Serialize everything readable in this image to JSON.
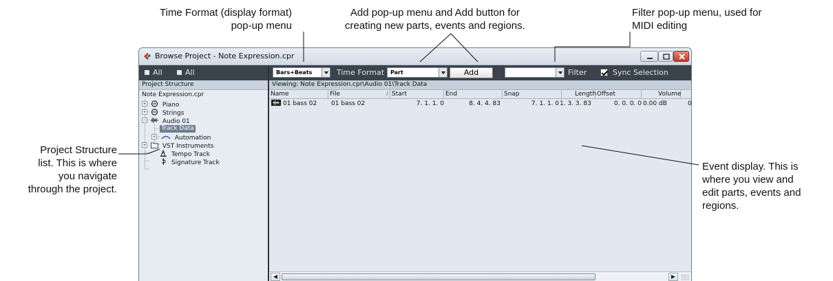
{
  "callouts": {
    "time_format": [
      "Time Format (display format)",
      "pop-up menu"
    ],
    "add_menu": [
      "Add pop-up menu and Add button for",
      "creating new parts, events and regions."
    ],
    "filter_menu": [
      "Filter pop-up menu, used for",
      "MIDI editing"
    ],
    "project_structure": [
      "Project Structure",
      "list. This is where",
      "you navigate",
      "through the project."
    ],
    "event_display": [
      "Event display. This is",
      "where you view and",
      "edit parts, events and",
      "regions."
    ]
  },
  "window": {
    "title": "Browse Project - Note Expression.cpr",
    "buttons": {
      "minimize": "minimize-icon",
      "maximize": "maximize-icon",
      "close": "close-icon"
    }
  },
  "toolbar": {
    "expand_all": "All",
    "collapse_all": "All",
    "time_format_value": "Bars+Beats",
    "time_format_label": "Time Format",
    "add_type_value": "Part",
    "add_button": "Add",
    "filter_value": "",
    "filter_label": "Filter",
    "sync_selection_label": "Sync Selection",
    "sync_selection_checked": true
  },
  "project_structure": {
    "header": "Project Structure",
    "items": [
      {
        "label": "Note Expression.cpr",
        "icon": "",
        "level": 0
      },
      {
        "label": "Piano",
        "icon": "midi-track-icon",
        "level": 1
      },
      {
        "label": "Strings",
        "icon": "midi-track-icon",
        "level": 1
      },
      {
        "label": "Audio 01",
        "icon": "audio-track-icon",
        "level": 1
      },
      {
        "label": "Track Data",
        "icon": "",
        "level": 2,
        "selected": true
      },
      {
        "label": "Automation",
        "icon": "automation-icon",
        "level": 2
      },
      {
        "label": "VST Instruments",
        "icon": "folder-icon",
        "level": 1
      },
      {
        "label": "Tempo Track",
        "icon": "tempo-icon",
        "level": 1
      },
      {
        "label": "Signature Track",
        "icon": "signature-icon",
        "level": 1
      }
    ]
  },
  "event_display": {
    "viewing": "Viewing: Note Expression.cpr\\Audio 01\\Track Data",
    "columns": [
      "Name",
      "File",
      "Start",
      "End",
      "Snap",
      "Length",
      "Offset",
      "Volume"
    ],
    "sort_indicator": "/",
    "rows": [
      {
        "name": "01 bass 02",
        "file": "01 bass 02",
        "start": "7. 1. 1.   0",
        "end": "8. 4. 4. 83",
        "snap": "7. 1. 1.   0",
        "length": "1. 3. 3. 83",
        "offset": "0. 0. 0.   0",
        "volume": "0.00 dB",
        "extra": "0"
      }
    ]
  },
  "colors": {
    "toolbar": "#3a424b",
    "panel": "#e1e8ef",
    "selected": "#6d7f92",
    "close_button": "#c3382a"
  }
}
